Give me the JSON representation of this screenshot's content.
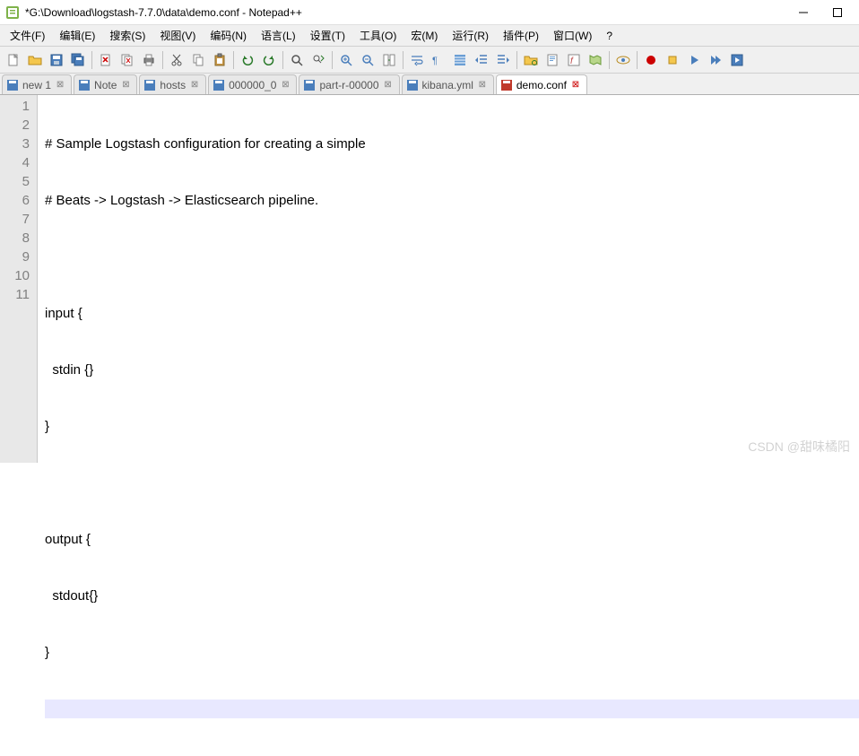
{
  "title": "*G:\\Download\\logstash-7.7.0\\data\\demo.conf - Notepad++",
  "menu": {
    "file": "文件(F)",
    "edit": "编辑(E)",
    "search": "搜索(S)",
    "view": "视图(V)",
    "encoding": "编码(N)",
    "language": "语言(L)",
    "settings": "设置(T)",
    "tools": "工具(O)",
    "macro": "宏(M)",
    "run": "运行(R)",
    "plugins": "插件(P)",
    "window": "窗口(W)",
    "help": "?"
  },
  "tabs": [
    {
      "label": "new 1",
      "active": false
    },
    {
      "label": "Note",
      "active": false
    },
    {
      "label": "hosts",
      "active": false
    },
    {
      "label": "000000_0",
      "active": false
    },
    {
      "label": "part-r-00000",
      "active": false
    },
    {
      "label": "kibana.yml",
      "active": false
    },
    {
      "label": "demo.conf",
      "active": true
    }
  ],
  "code": {
    "lines": [
      "# Sample Logstash configuration for creating a simple",
      "# Beats -> Logstash -> Elasticsearch pipeline.",
      "",
      "input {",
      "  stdin {}",
      "}",
      "",
      "output {",
      "  stdout{}",
      "}",
      ""
    ],
    "current_line_index": 10
  },
  "gutter": {
    "lines": [
      "1",
      "2",
      "3",
      "4",
      "5",
      "6",
      "7",
      "8",
      "9",
      "10",
      "11"
    ]
  },
  "watermark": "CSDN @甜味橘阳"
}
